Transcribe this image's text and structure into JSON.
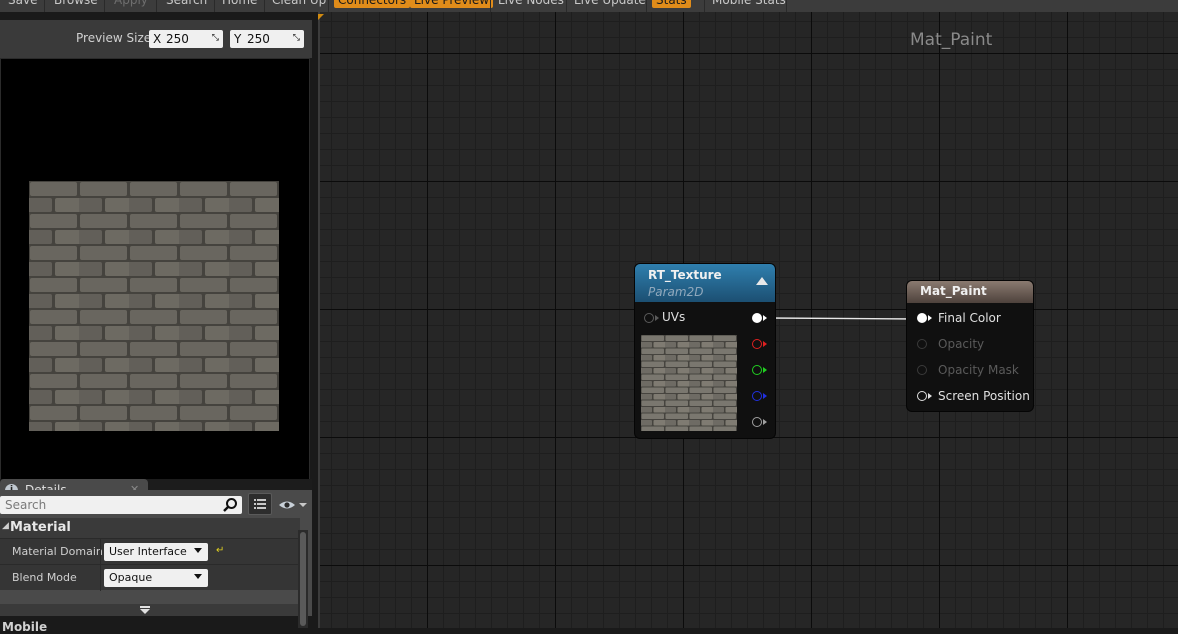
{
  "toolbar": {
    "buttons": [
      {
        "label": "Save",
        "state": "normal"
      },
      {
        "label": "Browse",
        "state": "normal"
      },
      {
        "label": "Apply",
        "state": "disabled"
      },
      {
        "label": "Search",
        "state": "normal"
      },
      {
        "label": "Home",
        "state": "normal"
      },
      {
        "label": "Clean Up",
        "state": "normal"
      },
      {
        "label": "Connectors",
        "state": "active"
      },
      {
        "label": "Live Preview",
        "state": "active"
      },
      {
        "label": "Live Nodes",
        "state": "normal"
      },
      {
        "label": "Live Update",
        "state": "normal"
      },
      {
        "label": "Stats",
        "state": "active"
      },
      {
        "label": "Mobile Stats",
        "state": "normal"
      }
    ]
  },
  "preview": {
    "size_label": "Preview Size",
    "x_axis": "X",
    "x_value": "250",
    "y_axis": "Y",
    "y_value": "250"
  },
  "details": {
    "tab_label": "Details",
    "search_placeholder": "Search",
    "category": "Material",
    "properties": [
      {
        "label": "Material Domain",
        "value": "User Interface"
      },
      {
        "label": "Blend Mode",
        "value": "Opaque"
      }
    ],
    "next_category": "Mobile"
  },
  "graph": {
    "title": "Mat_Paint",
    "texture_node": {
      "title": "RT_Texture",
      "subtitle": "Param2D",
      "input_label": "UVs",
      "output_colors": [
        "#ffffff",
        "#e02020",
        "#20d020",
        "#2030e0",
        "#a0a0a0"
      ]
    },
    "material_node": {
      "title": "Mat_Paint",
      "pins": [
        {
          "label": "Final Color",
          "enabled": true
        },
        {
          "label": "Opacity",
          "enabled": false
        },
        {
          "label": "Opacity Mask",
          "enabled": false
        },
        {
          "label": "Screen Position",
          "enabled": true
        }
      ]
    }
  },
  "colors": {
    "accent_orange": "#e08c1a",
    "texture_header": "#2a6f9a",
    "material_header": "#6a5a50"
  }
}
